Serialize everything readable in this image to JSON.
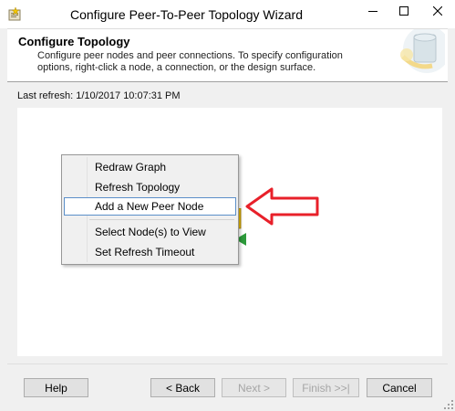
{
  "window": {
    "title": "Configure Peer-To-Peer Topology Wizard",
    "icon": "wizard-app-icon"
  },
  "header": {
    "title": "Configure Topology",
    "description": "Configure peer nodes and peer connections. To specify configuration options, right-click a node, a connection, or the design surface."
  },
  "refresh": {
    "text": "Last refresh: 1/10/2017 10:07:31 PM"
  },
  "context_menu": {
    "items": [
      {
        "label": "Redraw Graph"
      },
      {
        "label": "Refresh Topology"
      },
      {
        "label": "Add a New Peer Node"
      },
      {
        "label": "Select Node(s) to View"
      },
      {
        "label": "Set Refresh Timeout"
      }
    ],
    "highlighted_index": 2
  },
  "buttons": {
    "help": "Help",
    "back": "< Back",
    "next": "Next >",
    "finish": "Finish >>|",
    "cancel": "Cancel"
  },
  "colors": {
    "arrow": "#e8202a",
    "highlight_border": "#5b8fc9"
  }
}
